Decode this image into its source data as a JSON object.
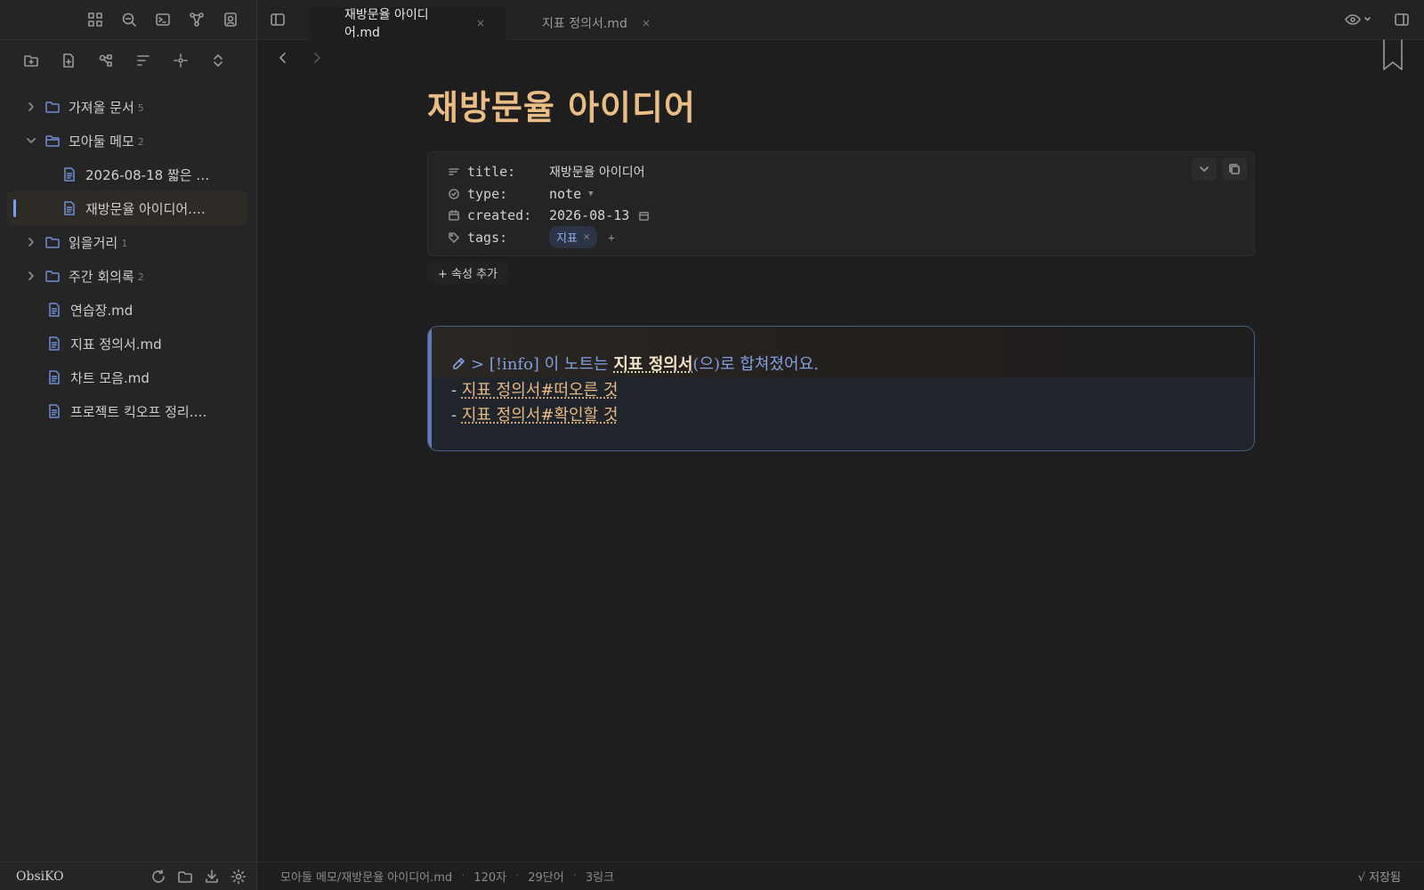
{
  "sidebar": {
    "top_icons": [
      "grid-icon",
      "search-icon",
      "terminal-icon",
      "graph-icon",
      "profile-icon"
    ],
    "tool_icons": [
      "new-folder-icon",
      "new-note-icon",
      "graph-nodes-icon",
      "sort-icon",
      "locate-icon",
      "collapse-expand-icon"
    ],
    "tree": [
      {
        "type": "folder",
        "label": "가져올 문서",
        "count": "5",
        "expanded": false
      },
      {
        "type": "folder",
        "label": "모아둘 메모",
        "count": "2",
        "expanded": true
      },
      {
        "type": "file",
        "label": "2026-08-18 짧은 …",
        "child": true
      },
      {
        "type": "file",
        "label": "재방문율 아이디어.…",
        "child": true,
        "active": true
      },
      {
        "type": "folder",
        "label": "읽을거리",
        "count": "1",
        "expanded": false
      },
      {
        "type": "folder",
        "label": "주간 회의록",
        "count": "2",
        "expanded": false
      },
      {
        "type": "file",
        "label": "연습장.md"
      },
      {
        "type": "file",
        "label": "지표 정의서.md"
      },
      {
        "type": "file",
        "label": "차트 모음.md"
      },
      {
        "type": "file",
        "label": "프로젝트 킥오프 정리.…"
      }
    ],
    "vault_name": "ObsiKO"
  },
  "tabs": [
    {
      "label": "재방문율 아이디어.md",
      "close": "×",
      "active": true
    },
    {
      "label": "지표 정의서.md",
      "close": "×",
      "active": false
    }
  ],
  "note": {
    "title": "재방문율 아이디어",
    "properties": [
      {
        "key": "title:",
        "value": "재방문율 아이디어",
        "icon": "text-lines-icon"
      },
      {
        "key": "type:",
        "value": "note",
        "icon": "circle-check-icon"
      },
      {
        "key": "created:",
        "value": "2026-08-13",
        "icon": "calendar-icon"
      },
      {
        "key": "tags:",
        "value": "지표",
        "icon": "tag-icon"
      }
    ],
    "tag_remove": "×",
    "tag_add": "+",
    "add_property": "+ 속성 추가",
    "callout": {
      "line1_prefix": "> [!info] 이 노트는 ",
      "line1_link": "지표 정의서",
      "line1_suffix": "(으)로 합쳐졌어요.",
      "items": [
        {
          "dash": "- ",
          "link": "지표 정의서#떠오른 것"
        },
        {
          "dash": "- ",
          "link": "지표 정의서#확인할 것"
        }
      ]
    }
  },
  "status": {
    "path": "모아둘 메모/재방문율 아이디어.md",
    "chars": "120자",
    "words": "29단어",
    "links": "3링크",
    "saved": "√ 저장됨"
  },
  "colors": {
    "title": "#e9bd84",
    "accent": "#7a9ef0",
    "link": "#e6b982"
  }
}
